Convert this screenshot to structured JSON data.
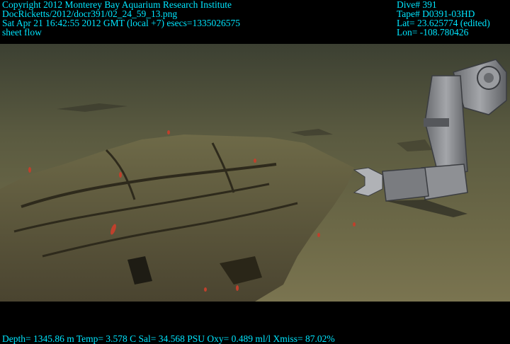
{
  "overlay": {
    "top_left": [
      "Copyright 2012 Monterey Bay Aquarium Research Institute",
      "DocRicketts/2012/docr391/02_24_59_13.png",
      "Sat Apr 21 16:42:55 2012 GMT (local +7)  esecs=1335026575",
      "sheet flow"
    ],
    "top_right": [
      "Dive# 391",
      "Tape# D0391-03HD",
      "Lat= 23.625774 (edited)",
      "Lon= -108.780426"
    ],
    "bottom": "Depth= 1345.86 m  Temp= 3.578 C  Sal= 34.568 PSU  Oxy= 0.489 ml/l  Xmiss= 87.02%"
  },
  "colors": {
    "overlay_text": "#00e6ff",
    "seafloor": "#6f6a48",
    "rock": "#5a5234",
    "manipulator": "#8a8c90"
  }
}
